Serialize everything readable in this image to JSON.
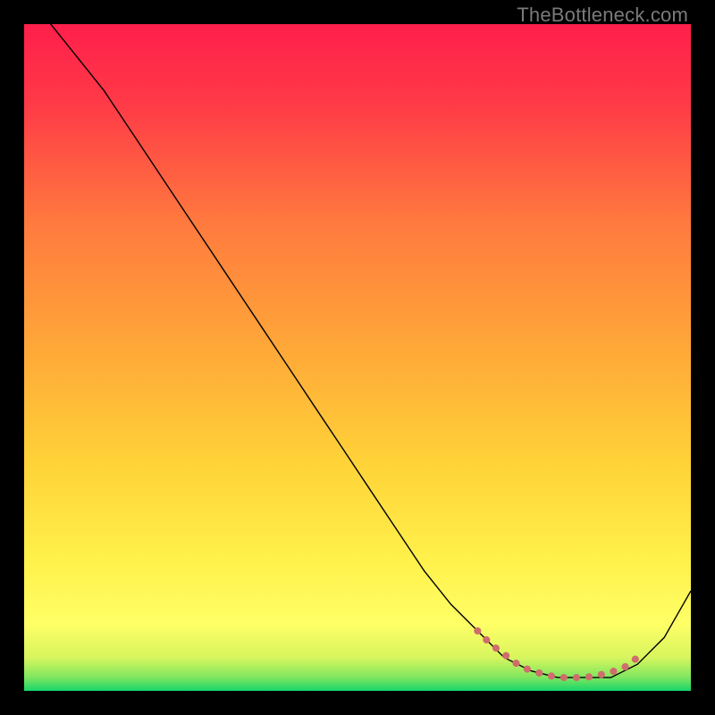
{
  "watermark": "TheBottleneck.com",
  "chart_data": {
    "type": "line",
    "title": "",
    "xlabel": "",
    "ylabel": "",
    "xlim": [
      0,
      100
    ],
    "ylim": [
      0,
      100
    ],
    "grid": false,
    "legend": false,
    "background_gradient": {
      "top_color": "#ff1f4b",
      "mid_color": "#ffd338",
      "lower_color": "#ffff66",
      "bottom_color": "#17d66a"
    },
    "series": [
      {
        "name": "bottleneck-curve",
        "stroke": "#000000",
        "stroke_width": 1.4,
        "x": [
          0,
          4,
          8,
          12,
          16,
          20,
          24,
          28,
          32,
          36,
          40,
          44,
          48,
          52,
          56,
          60,
          64,
          68,
          72,
          76,
          80,
          84,
          88,
          92,
          96,
          100
        ],
        "y": [
          103,
          100,
          95,
          90,
          84,
          78,
          72,
          66,
          60,
          54,
          48,
          42,
          36,
          30,
          24,
          18,
          13,
          9,
          5,
          3,
          2,
          2,
          2,
          4,
          8,
          15
        ]
      },
      {
        "name": "optimal-range-marker",
        "stroke": "#cf6d6d",
        "stroke_width": 8,
        "linecap": "round",
        "dash": "0.1 14",
        "x": [
          68,
          70,
          72,
          74,
          76,
          78,
          80,
          82,
          84,
          86,
          88,
          90,
          92
        ],
        "y": [
          9,
          7,
          5.5,
          4,
          3,
          2.5,
          2,
          2,
          2,
          2.3,
          2.8,
          3.5,
          5
        ]
      }
    ]
  }
}
